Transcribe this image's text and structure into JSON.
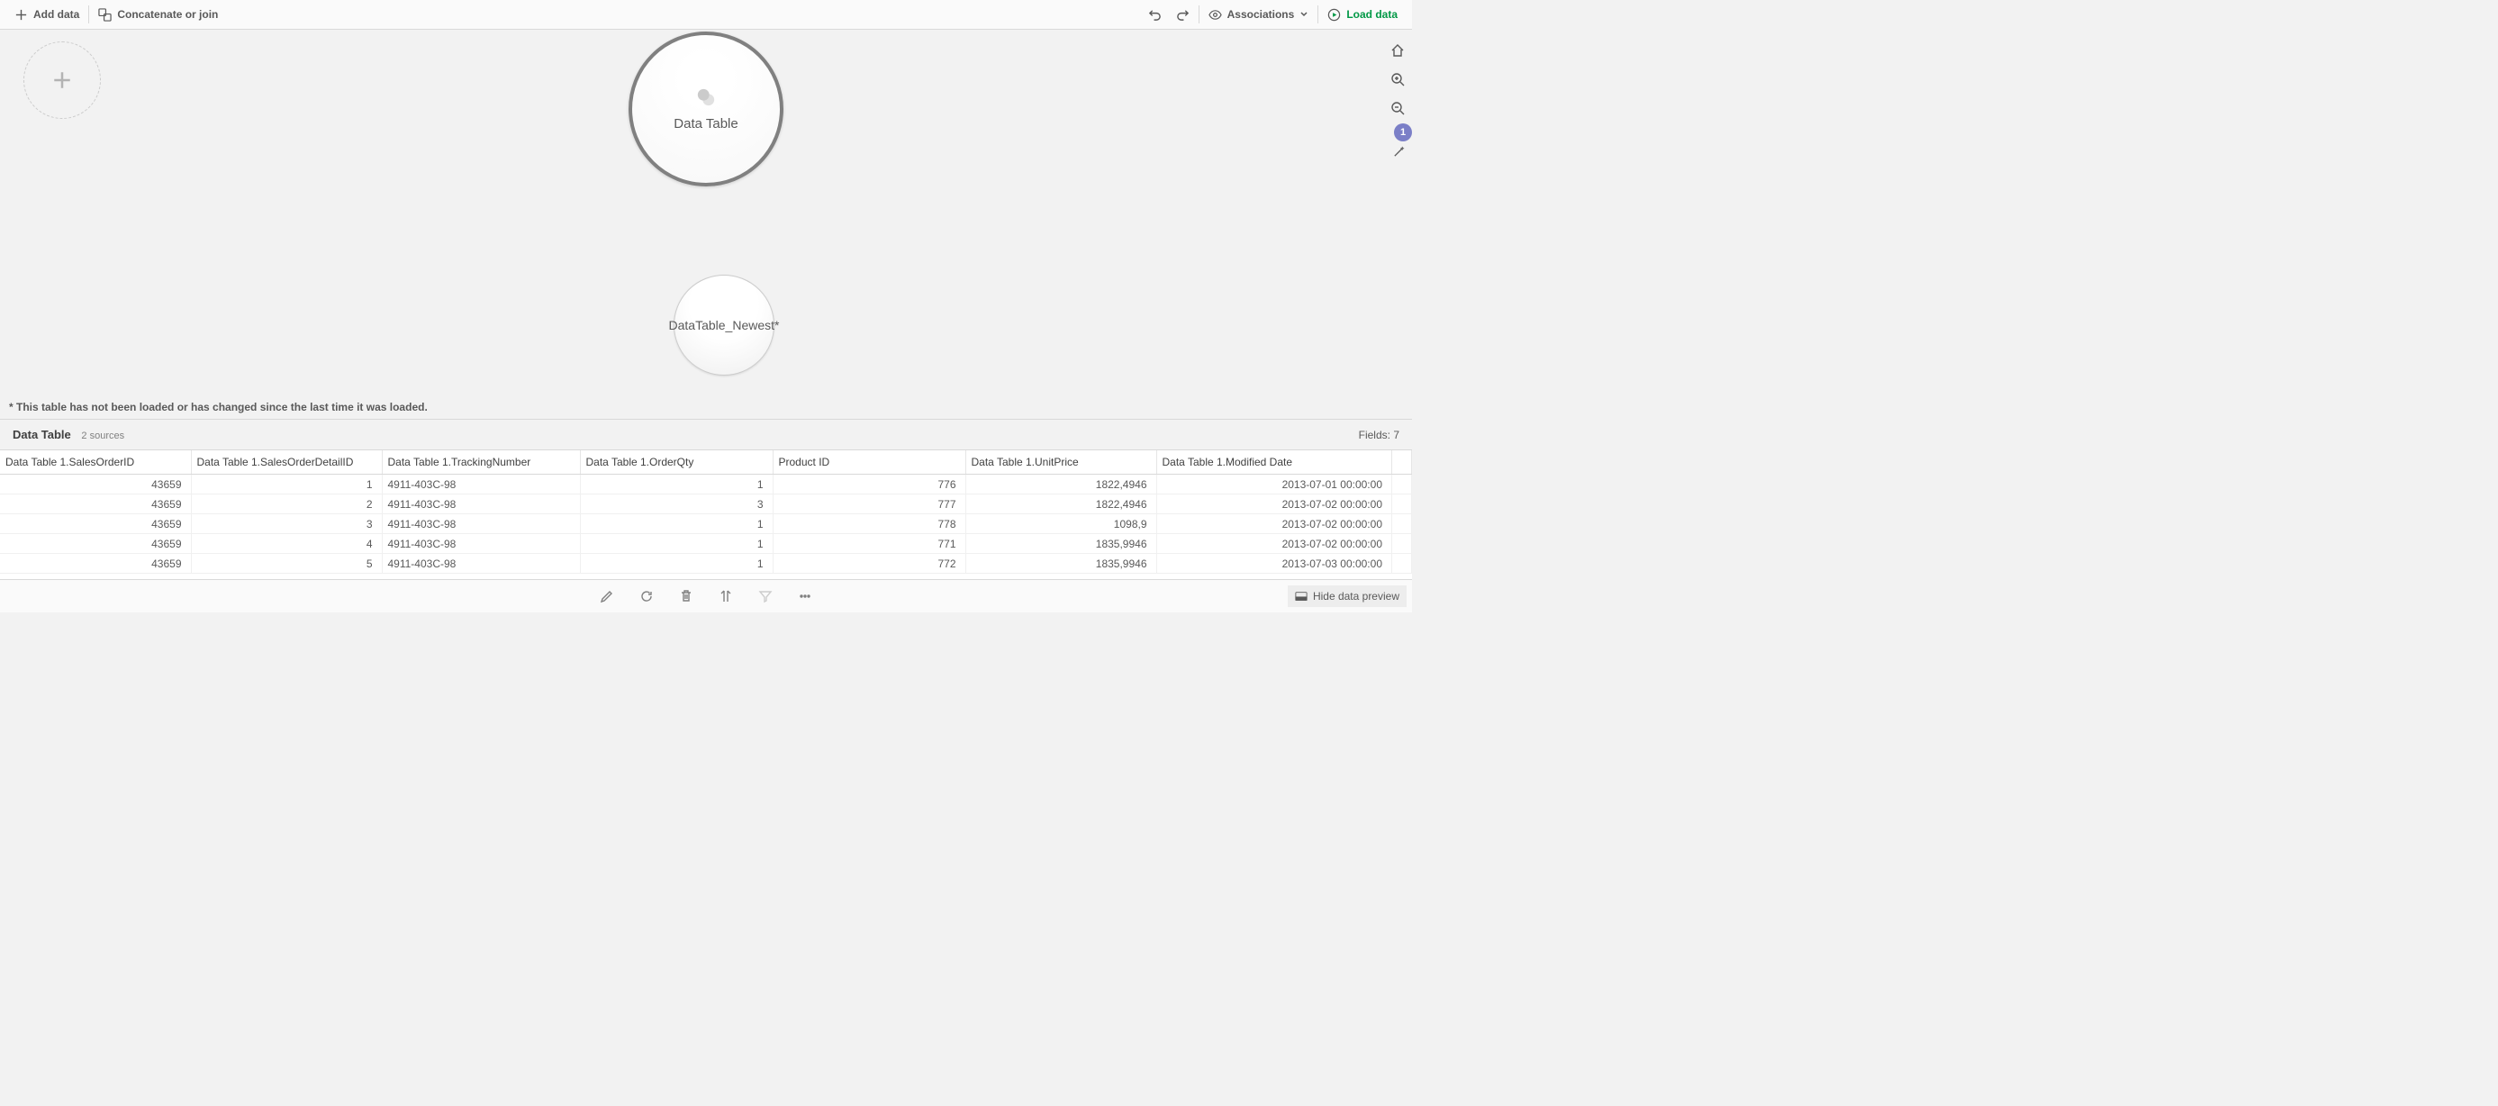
{
  "toolbar": {
    "add_data": "Add data",
    "concat_join": "Concatenate or join",
    "associations": "Associations",
    "load_data": "Load data"
  },
  "canvas": {
    "main_bubble": "Data Table",
    "small_bubble": "DataTable_Newest*",
    "note": "* This table has not been loaded or has changed since the last time it was loaded."
  },
  "side": {
    "badge": "1"
  },
  "preview": {
    "title": "Data Table",
    "sources": "2 sources",
    "fields_label": "Fields: 7",
    "columns": [
      "Data Table 1.SalesOrderID",
      "Data Table 1.SalesOrderDetailID",
      "Data Table 1.TrackingNumber",
      "Data Table 1.OrderQty",
      "Product ID",
      "Data Table 1.UnitPrice",
      "Data Table 1.Modified Date"
    ],
    "rows": [
      [
        "43659",
        "1",
        "4911-403C-98",
        "1",
        "776",
        "1822,4946",
        "2013-07-01 00:00:00"
      ],
      [
        "43659",
        "2",
        "4911-403C-98",
        "3",
        "777",
        "1822,4946",
        "2013-07-02 00:00:00"
      ],
      [
        "43659",
        "3",
        "4911-403C-98",
        "1",
        "778",
        "1098,9",
        "2013-07-02 00:00:00"
      ],
      [
        "43659",
        "4",
        "4911-403C-98",
        "1",
        "771",
        "1835,9946",
        "2013-07-02 00:00:00"
      ],
      [
        "43659",
        "5",
        "4911-403C-98",
        "1",
        "772",
        "1835,9946",
        "2013-07-03 00:00:00"
      ]
    ]
  },
  "bottom": {
    "hide_preview": "Hide data preview"
  }
}
